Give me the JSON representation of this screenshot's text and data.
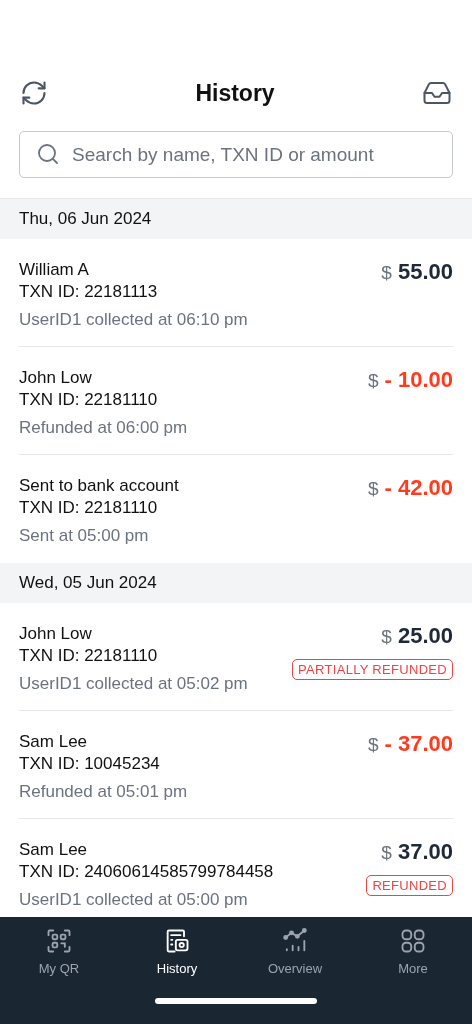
{
  "header": {
    "title": "History"
  },
  "search": {
    "placeholder": "Search by name, TXN ID or amount"
  },
  "groups": [
    {
      "date": "Thu, 06 Jun 2024",
      "transactions": [
        {
          "name": "William A",
          "txn": "TXN ID: 22181113",
          "note": "UserID1 collected at 06:10 pm",
          "currency": "$",
          "amount": "55.00",
          "kind": "credit"
        },
        {
          "name": "John Low",
          "txn": "TXN ID: 22181110",
          "note": "Refunded at 06:00 pm",
          "currency": "$",
          "amount": "- 10.00",
          "kind": "debit"
        },
        {
          "name": "Sent to bank account",
          "txn": "TXN ID: 22181110",
          "note": "Sent at 05:00 pm",
          "currency": "$",
          "amount": "- 42.00",
          "kind": "debit"
        }
      ]
    },
    {
      "date": "Wed, 05 Jun 2024",
      "transactions": [
        {
          "name": "John Low",
          "txn": "TXN ID: 22181110",
          "note": "UserID1 collected at 05:02 pm",
          "currency": "$",
          "amount": "25.00",
          "kind": "credit",
          "badge": "PARTIALLY REFUNDED"
        },
        {
          "name": "Sam Lee",
          "txn": "TXN ID: 10045234",
          "note": "Refunded at 05:01 pm",
          "currency": "$",
          "amount": "- 37.00",
          "kind": "debit"
        },
        {
          "name": "Sam Lee",
          "txn": "TXN ID: 24060614585799784458",
          "note": "UserID1 collected at 05:00 pm",
          "currency": "$",
          "amount": "37.00",
          "kind": "credit",
          "badge": "REFUNDED"
        }
      ]
    }
  ],
  "tabs": [
    {
      "label": "My QR",
      "kind": "qr",
      "selected": false
    },
    {
      "label": "History",
      "kind": "receipt",
      "selected": true
    },
    {
      "label": "Overview",
      "kind": "chart",
      "selected": false
    },
    {
      "label": "More",
      "kind": "grid",
      "selected": false
    }
  ]
}
